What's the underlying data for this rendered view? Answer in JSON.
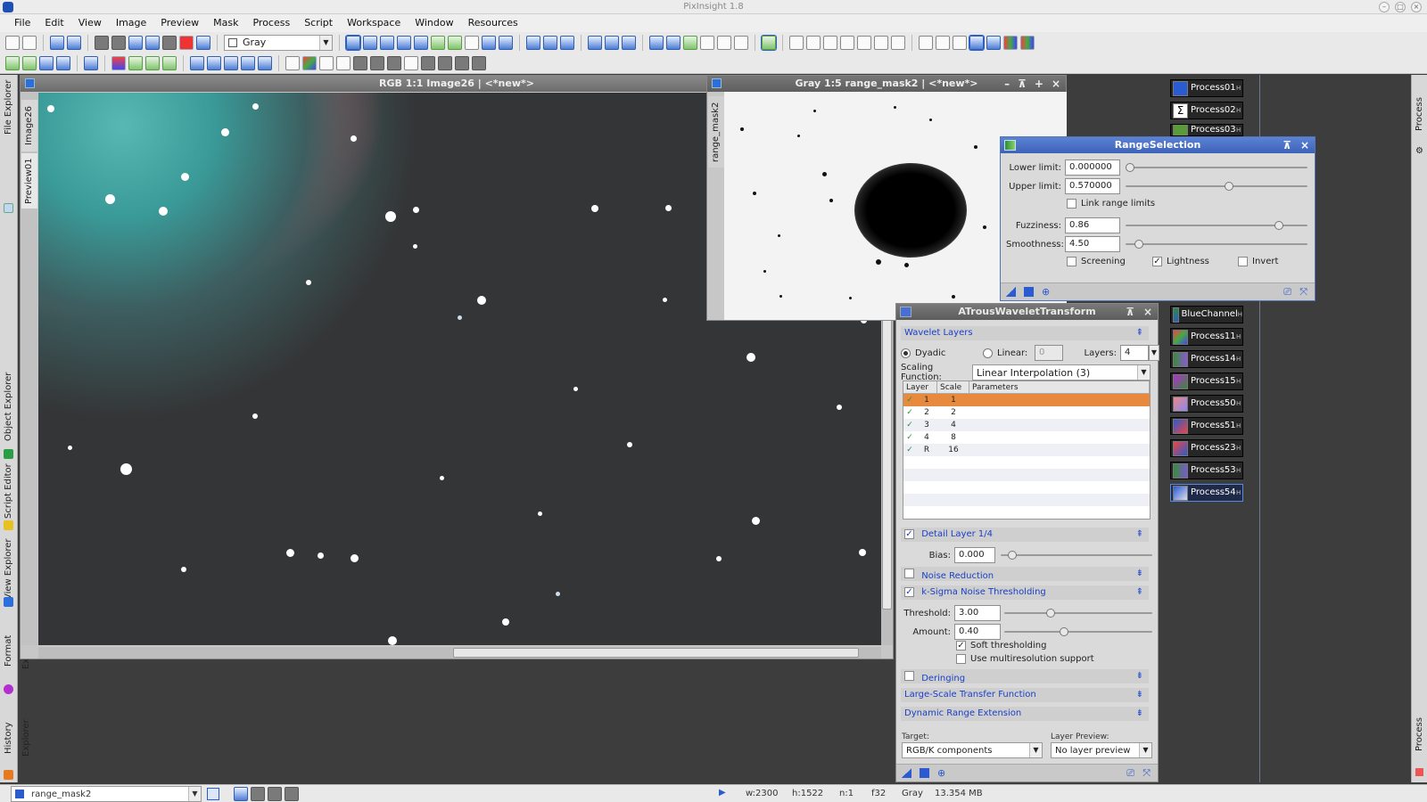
{
  "app": {
    "title": "PixInsight 1.8"
  },
  "menu": [
    "File",
    "Edit",
    "View",
    "Image",
    "Preview",
    "Mask",
    "Process",
    "Script",
    "Workspace",
    "Window",
    "Resources"
  ],
  "toolbar": {
    "image_mode": "Gray"
  },
  "left_dock": {
    "tabs": [
      "File Explorer",
      "Object Explorer",
      "Script Editor",
      "View Explorer",
      "Format Explorer",
      "History Explorer"
    ]
  },
  "right_dock": {
    "tabs": [
      "Process Explorer",
      "Process Console"
    ]
  },
  "main_window": {
    "title": "RGB 1:1 Image26 | <*new*>",
    "side_tabs": [
      "Image26",
      "Preview01"
    ]
  },
  "mask_window": {
    "title": "Gray 1:5 range_mask2 | <*new*>",
    "side_tab": "range_mask2"
  },
  "range_selection": {
    "title": "RangeSelection",
    "lower_label": "Lower limit:",
    "lower_value": "0.000000",
    "upper_label": "Upper limit:",
    "upper_value": "0.570000",
    "link_label": "Link range limits",
    "fuzziness_label": "Fuzziness:",
    "fuzziness_value": "0.86",
    "smoothness_label": "Smoothness:",
    "smoothness_value": "4.50",
    "screening_label": "Screening",
    "lightness_label": "Lightness",
    "invert_label": "Invert",
    "sliders": {
      "lower": 0.0,
      "upper": 0.57,
      "fuzziness": 0.86,
      "smoothness": 0.05
    }
  },
  "atrous": {
    "title": "ATrousWaveletTransform",
    "wavelet_layers": "Wavelet Layers",
    "dyadic": "Dyadic",
    "linear": "Linear:",
    "linear_value": "0",
    "layers_label": "Layers:",
    "layers_value": "4",
    "scaling_label": "Scaling Function:",
    "scaling_value": "Linear Interpolation (3)",
    "table_headers": [
      "Layer",
      "Scale",
      "Parameters"
    ],
    "table_rows": [
      [
        "1",
        "1"
      ],
      [
        "2",
        "2"
      ],
      [
        "3",
        "4"
      ],
      [
        "4",
        "8"
      ],
      [
        "R",
        "16"
      ]
    ],
    "detail_layer": "Detail Layer 1/4",
    "bias_label": "Bias:",
    "bias_value": "0.000",
    "noise_reduction": "Noise Reduction",
    "ksigma": "k-Sigma Noise Thresholding",
    "threshold_label": "Threshold:",
    "threshold_value": "3.00",
    "amount_label": "Amount:",
    "amount_value": "0.40",
    "soft_label": "Soft thresholding",
    "multires_label": "Use multiresolution support",
    "deringing": "Deringing",
    "lstf": "Large-Scale Transfer Function",
    "dre": "Dynamic Range Extension",
    "target_label": "Target:",
    "target_value": "RGB/K components",
    "preview_label": "Layer Preview:",
    "preview_value": "No layer preview"
  },
  "process_icons": {
    "top": [
      "Process01",
      "Process02",
      "Process03"
    ],
    "bottom": [
      "BlueChannel",
      "Process11",
      "Process14",
      "Process15",
      "Process50",
      "Process51",
      "Process23",
      "Process53",
      "Process54"
    ],
    "ghost": "Process"
  },
  "status": {
    "view_name": "range_mask2",
    "width": "w:2300",
    "height": "h:1522",
    "channels": "n:1",
    "bits": "f32",
    "color": "Gray",
    "size": "13.354 MB"
  },
  "colors": {
    "accent": "#3b63b8",
    "selected_row": "#e88a3d",
    "link_text": "#1b3fc7"
  }
}
